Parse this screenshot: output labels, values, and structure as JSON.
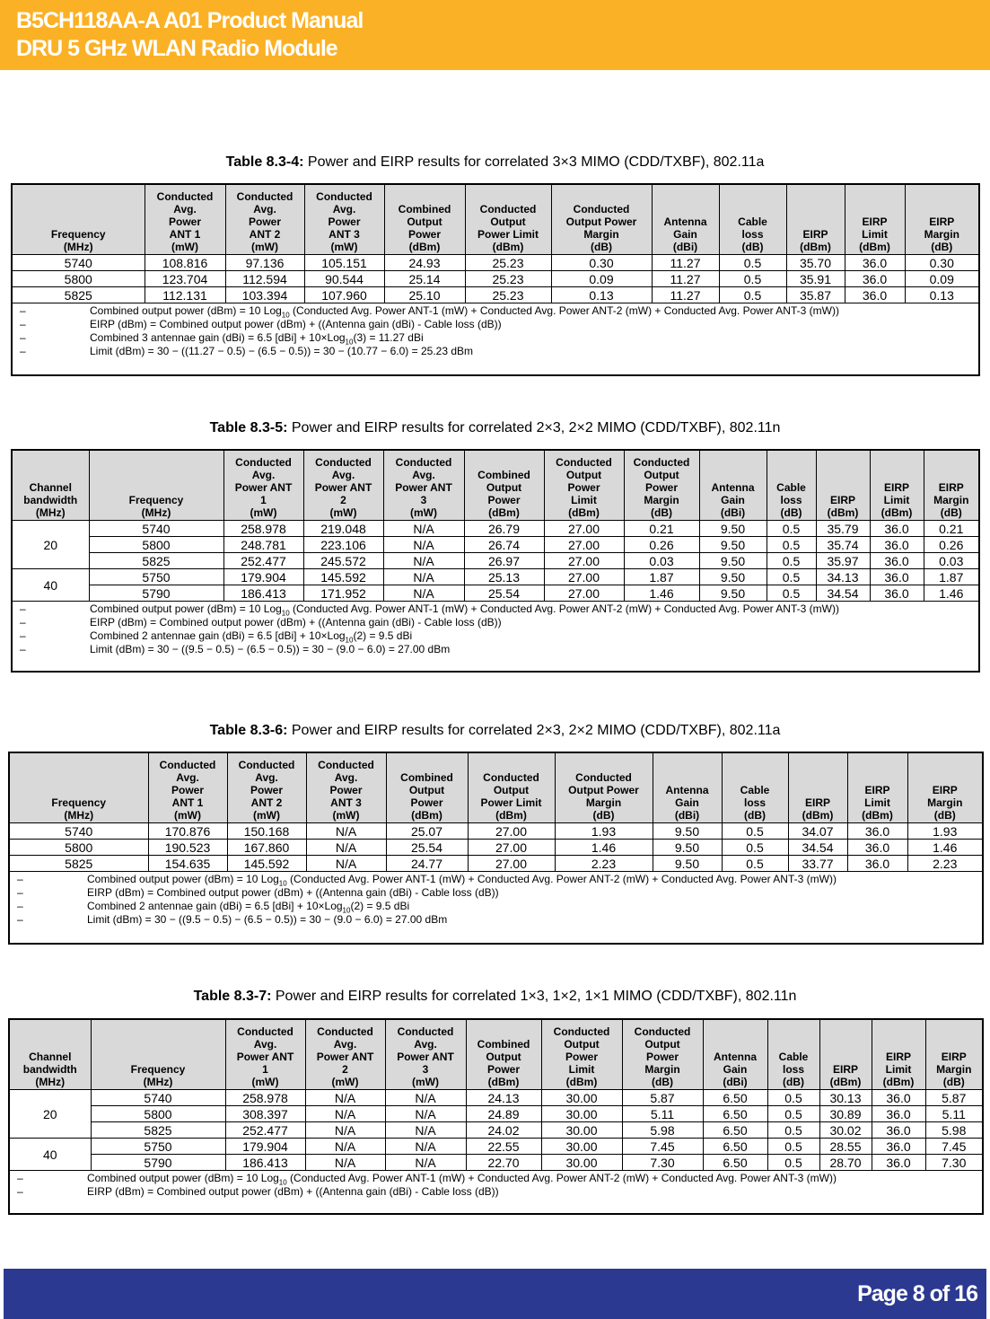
{
  "header": {
    "line1": "B5CH118AA-A A01 Product Manual",
    "line2": "DRU 5 GHz WLAN Radio Module",
    "color": "#fbb125"
  },
  "footer": {
    "page": "Page 8 of 16",
    "color": "#2b3990"
  },
  "tables": [
    {
      "title_bold": "Table 8.3-4:",
      "title": " Power and EIRP results for correlated 3×3 MIMO (CDD/TXBF), 802.11a",
      "headers": [
        "Frequency\n(MHz)\n",
        "Conducted\nAvg.\nPower\nANT 1\n(mW)",
        "Conducted\nAvg.\nPower\nANT 2\n(mW)",
        "Conducted\nAvg.\nPower\nANT 3\n(mW)",
        "Combined\nOutput\nPower\n(dBm)",
        "Conducted\nOutput\nPower Limit\n(dBm)",
        "Conducted\nOutput Power\nMargin\n(dB)",
        "Antenna\nGain\n(dBi)",
        "Cable\nloss\n(dB)",
        "EIRP\n(dBm)",
        "EIRP\nLimit\n(dBm)",
        "EIRP\nMargin\n(dB)"
      ],
      "rows": [
        [
          "5740",
          "108.816",
          "97.136",
          "105.151",
          "24.93",
          "25.23",
          "0.30",
          "11.27",
          "0.5",
          "35.70",
          "36.0",
          "0.30"
        ],
        [
          "5800",
          "123.704",
          "112.594",
          "90.544",
          "25.14",
          "25.23",
          "0.09",
          "11.27",
          "0.5",
          "35.91",
          "36.0",
          "0.09"
        ],
        [
          "5825",
          "112.131",
          "103.394",
          "107.960",
          "25.10",
          "25.23",
          "0.13",
          "11.27",
          "0.5",
          "35.87",
          "36.0",
          "0.13"
        ]
      ],
      "notes": [
        [
          {
            "t": "Combined output power (dBm) = 10 Log"
          },
          {
            "sub": "10"
          },
          {
            "t": " (Conducted Avg. Power ANT-1 (mW) + Conducted Avg. Power ANT-2 (mW) + Conducted Avg. Power ANT-3 (mW))"
          }
        ],
        [
          {
            "t": "EIRP (dBm) = Combined output power (dBm) + ((Antenna gain (dBi) - Cable loss (dB))"
          }
        ],
        [
          {
            "t": "Combined 3 antennae gain (dBi) = 6.5 [dBi] + 10×Log"
          },
          {
            "sub": "10"
          },
          {
            "t": "(3) = 11.27 dBi"
          }
        ],
        [
          {
            "t": "Limit (dBm) = 30 − ((11.27 − 0.5) − (6.5 − 0.5)) = 30 − (10.77 − 6.0) = 25.23 dBm"
          }
        ]
      ]
    },
    {
      "title_bold": "Table 8.3-5:",
      "title": " Power and EIRP results for correlated 2×3, 2×2 MIMO (CDD/TXBF), 802.11n",
      "headers": [
        "Channel\nbandwidth\n(MHz)",
        "Frequency\n(MHz)\n",
        "Conducted\nAvg.\nPower ANT\n1\n(mW)",
        "Conducted\nAvg.\nPower ANT\n2\n(mW)",
        "Conducted\nAvg.\nPower ANT\n3\n(mW)",
        "Combined\nOutput\nPower\n(dBm)",
        "Conducted\nOutput\nPower\nLimit\n(dBm)",
        "Conducted\nOutput\nPower\nMargin\n(dB)",
        "Antenna\nGain\n(dBi)",
        "Cable\nloss\n(dB)",
        "EIRP\n(dBm)",
        "EIRP\nLimit\n(dBm)",
        "EIRP\nMargin\n(dB)"
      ],
      "groups": [
        {
          "bandwidth": "20",
          "rows": [
            [
              "5740",
              "258.978",
              "219.048",
              "N/A",
              "26.79",
              "27.00",
              "0.21",
              "9.50",
              "0.5",
              "35.79",
              "36.0",
              "0.21"
            ],
            [
              "5800",
              "248.781",
              "223.106",
              "N/A",
              "26.74",
              "27.00",
              "0.26",
              "9.50",
              "0.5",
              "35.74",
              "36.0",
              "0.26"
            ],
            [
              "5825",
              "252.477",
              "245.572",
              "N/A",
              "26.97",
              "27.00",
              "0.03",
              "9.50",
              "0.5",
              "35.97",
              "36.0",
              "0.03"
            ]
          ]
        },
        {
          "bandwidth": "40",
          "rows": [
            [
              "5750",
              "179.904",
              "145.592",
              "N/A",
              "25.13",
              "27.00",
              "1.87",
              "9.50",
              "0.5",
              "34.13",
              "36.0",
              "1.87"
            ],
            [
              "5790",
              "186.413",
              "171.952",
              "N/A",
              "25.54",
              "27.00",
              "1.46",
              "9.50",
              "0.5",
              "34.54",
              "36.0",
              "1.46"
            ]
          ]
        }
      ],
      "notes": [
        [
          {
            "t": "Combined output power (dBm) = 10 Log"
          },
          {
            "sub": "10"
          },
          {
            "t": " (Conducted Avg. Power ANT-1 (mW) + Conducted Avg. Power ANT-2 (mW) + Conducted Avg. Power ANT-3 (mW))"
          }
        ],
        [
          {
            "t": "EIRP (dBm) = Combined output power (dBm) + ((Antenna gain (dBi) - Cable loss (dB))"
          }
        ],
        [
          {
            "t": "Combined 2 antennae gain (dBi) = 6.5 [dBi] + 10×Log"
          },
          {
            "sub": "10"
          },
          {
            "t": "(2) = 9.5 dBi"
          }
        ],
        [
          {
            "t": "Limit (dBm) = 30 − ((9.5 − 0.5) − (6.5 − 0.5)) = 30 − (9.0 − 6.0) = 27.00 dBm"
          }
        ]
      ]
    },
    {
      "title_bold": "Table 8.3-6:",
      "title": " Power and EIRP results for correlated 2×3, 2×2 MIMO (CDD/TXBF), 802.11a",
      "headers": [
        "Frequency\n(MHz)\n",
        "Conducted\nAvg.\nPower\nANT 1\n(mW)",
        "Conducted\nAvg.\nPower\nANT 2\n(mW)",
        "Conducted\nAvg.\nPower\nANT 3\n(mW)",
        "Combined\nOutput\nPower\n(dBm)",
        "Conducted\nOutput\nPower Limit\n(dBm)",
        "Conducted\nOutput Power\nMargin\n(dB)",
        "Antenna\nGain\n(dBi)",
        "Cable\nloss\n(dB)",
        "EIRP\n(dBm)",
        "EIRP\nLimit\n(dBm)",
        "EIRP\nMargin\n(dB)"
      ],
      "rows": [
        [
          "5740",
          "170.876",
          "150.168",
          "N/A",
          "25.07",
          "27.00",
          "1.93",
          "9.50",
          "0.5",
          "34.07",
          "36.0",
          "1.93"
        ],
        [
          "5800",
          "190.523",
          "167.860",
          "N/A",
          "25.54",
          "27.00",
          "1.46",
          "9.50",
          "0.5",
          "34.54",
          "36.0",
          "1.46"
        ],
        [
          "5825",
          "154.635",
          "145.592",
          "N/A",
          "24.77",
          "27.00",
          "2.23",
          "9.50",
          "0.5",
          "33.77",
          "36.0",
          "2.23"
        ]
      ],
      "notes": [
        [
          {
            "t": "Combined output power (dBm) = 10 Log"
          },
          {
            "sub": "10"
          },
          {
            "t": " (Conducted Avg. Power ANT-1 (mW) + Conducted Avg. Power ANT-2 (mW) + Conducted Avg. Power ANT-3 (mW))"
          }
        ],
        [
          {
            "t": "EIRP (dBm) = Combined output power (dBm) + ((Antenna gain (dBi) - Cable loss (dB))"
          }
        ],
        [
          {
            "t": "Combined 2 antennae gain (dBi) = 6.5 [dBi] + 10×Log"
          },
          {
            "sub": "10"
          },
          {
            "t": "(2) = 9.5 dBi"
          }
        ],
        [
          {
            "t": "Limit (dBm) = 30 − ((9.5 − 0.5) − (6.5 − 0.5)) = 30 − (9.0 − 6.0) = 27.00 dBm"
          }
        ]
      ]
    },
    {
      "title_bold": "Table 8.3-7:",
      "title": " Power and EIRP results for correlated 1×3, 1×2, 1×1 MIMO (CDD/TXBF), 802.11n",
      "headers": [
        "Channel\nbandwidth\n(MHz)",
        "Frequency\n(MHz)\n",
        "Conducted\nAvg.\nPower ANT\n1\n(mW)",
        "Conducted\nAvg.\nPower ANT\n2\n(mW)",
        "Conducted\nAvg.\nPower ANT\n3\n(mW)",
        "Combined\nOutput\nPower\n(dBm)",
        "Conducted\nOutput\nPower\nLimit\n(dBm)",
        "Conducted\nOutput\nPower\nMargin\n(dB)",
        "Antenna\nGain\n(dBi)",
        "Cable\nloss\n(dB)",
        "EIRP\n(dBm)",
        "EIRP\nLimit\n(dBm)",
        "EIRP\nMargin\n(dB)"
      ],
      "groups": [
        {
          "bandwidth": "20",
          "rows": [
            [
              "5740",
              "258.978",
              "N/A",
              "N/A",
              "24.13",
              "30.00",
              "5.87",
              "6.50",
              "0.5",
              "30.13",
              "36.0",
              "5.87"
            ],
            [
              "5800",
              "308.397",
              "N/A",
              "N/A",
              "24.89",
              "30.00",
              "5.11",
              "6.50",
              "0.5",
              "30.89",
              "36.0",
              "5.11"
            ],
            [
              "5825",
              "252.477",
              "N/A",
              "N/A",
              "24.02",
              "30.00",
              "5.98",
              "6.50",
              "0.5",
              "30.02",
              "36.0",
              "5.98"
            ]
          ]
        },
        {
          "bandwidth": "40",
          "rows": [
            [
              "5750",
              "179.904",
              "N/A",
              "N/A",
              "22.55",
              "30.00",
              "7.45",
              "6.50",
              "0.5",
              "28.55",
              "36.0",
              "7.45"
            ],
            [
              "5790",
              "186.413",
              "N/A",
              "N/A",
              "22.70",
              "30.00",
              "7.30",
              "6.50",
              "0.5",
              "28.70",
              "36.0",
              "7.30"
            ]
          ]
        }
      ],
      "notes": [
        [
          {
            "t": "Combined output power (dBm) = 10 Log"
          },
          {
            "sub": "10"
          },
          {
            "t": " (Conducted Avg. Power ANT-1 (mW) + Conducted Avg. Power ANT-2 (mW) + Conducted Avg. Power ANT-3 (mW))"
          }
        ],
        [
          {
            "t": "EIRP (dBm) = Combined output power (dBm) + ((Antenna gain (dBi) - Cable loss (dB))"
          }
        ]
      ]
    }
  ]
}
